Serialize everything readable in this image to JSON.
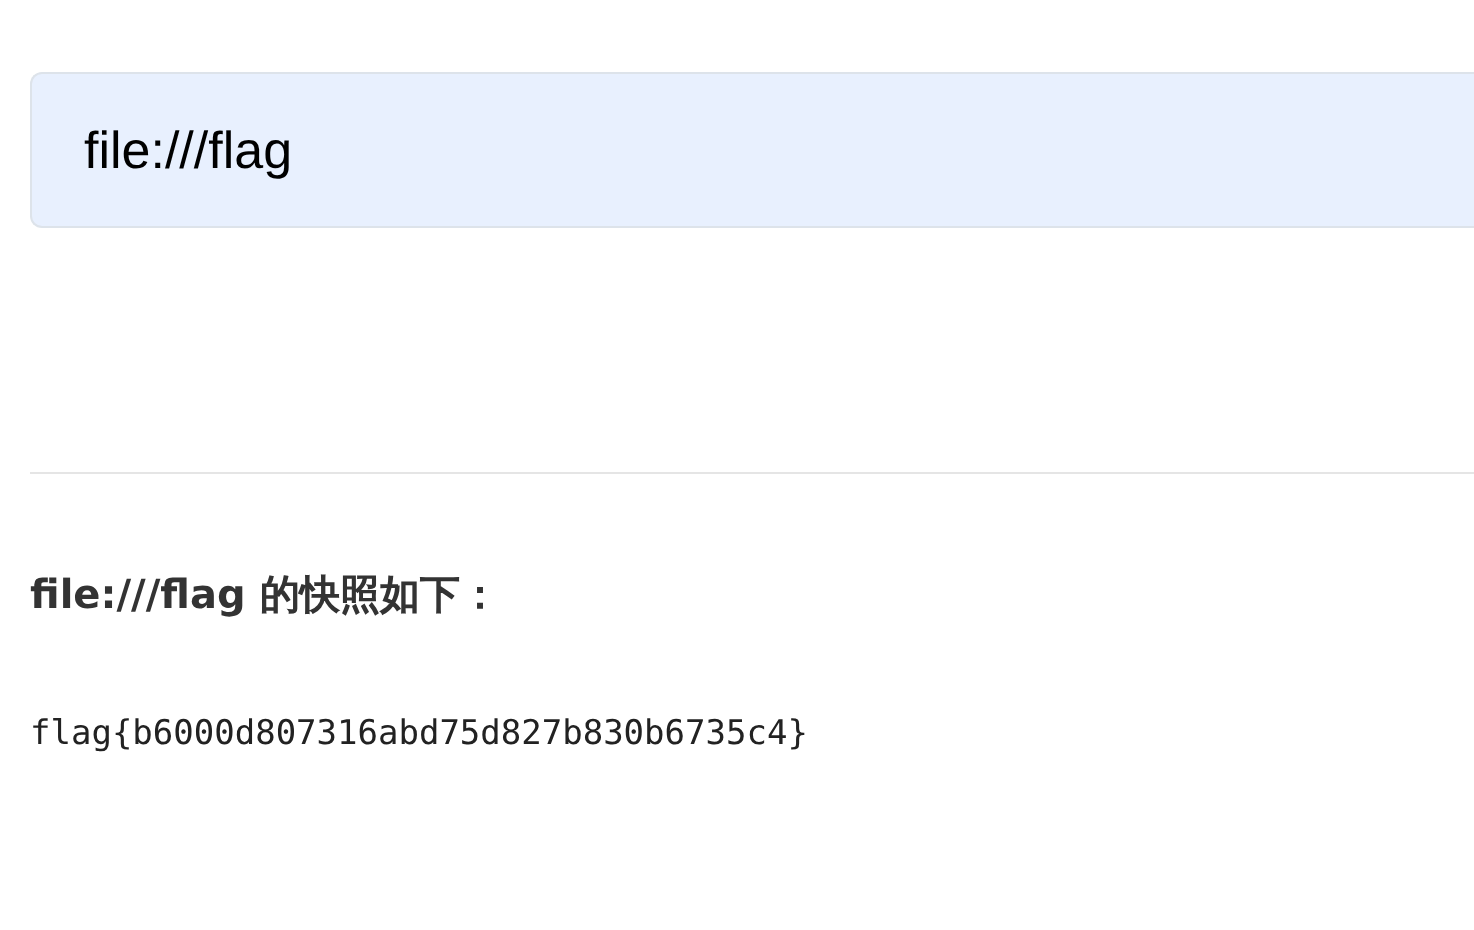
{
  "url_field": {
    "value": "file:///flag"
  },
  "snapshot": {
    "heading": "file:///flag 的快照如下：",
    "content": "flag{b6000d807316abd75d827b830b6735c4}"
  }
}
